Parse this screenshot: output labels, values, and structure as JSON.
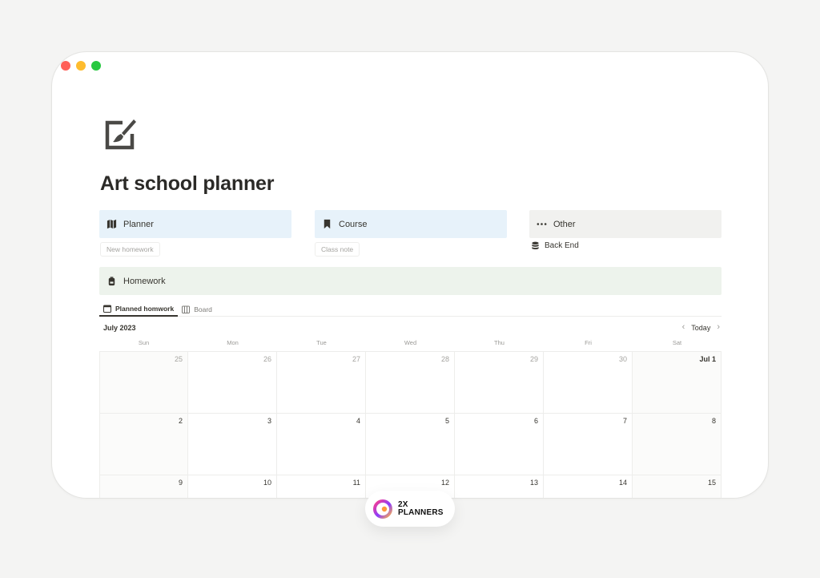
{
  "window": {
    "traffic_lights": {
      "close": "#ff5f57",
      "minimize": "#febc2e",
      "zoom": "#28c840"
    }
  },
  "page": {
    "icon": "edit-brush-icon",
    "title": "Art school planner"
  },
  "callouts": {
    "planner": {
      "icon": "map-icon",
      "label": "Planner",
      "color": "#e7f2fa"
    },
    "course": {
      "icon": "bookmark-icon",
      "label": "Course",
      "color": "#e7f2fa"
    },
    "other": {
      "icon": "more-horizontal-icon",
      "label": "Other",
      "color": "#f1f1ef"
    },
    "homework": {
      "icon": "backpack-icon",
      "label": "Homework",
      "color": "#edf3ec"
    }
  },
  "buttons": {
    "new_homework": "New homework",
    "class_note": "Class note"
  },
  "links": {
    "back_end": {
      "icon": "database-icon",
      "label": "Back End"
    }
  },
  "views": {
    "tabs": [
      {
        "icon": "calendar-icon",
        "label": "Planned homwork",
        "active": true
      },
      {
        "icon": "board-icon",
        "label": "Board",
        "active": false
      }
    ]
  },
  "calendar": {
    "month": "July 2023",
    "today_label": "Today",
    "prev_icon": "chevron-left-icon",
    "next_icon": "chevron-right-icon",
    "weekdays": [
      "Sun",
      "Mon",
      "Tue",
      "Wed",
      "Thu",
      "Fri",
      "Sat"
    ],
    "days": [
      "25",
      "26",
      "27",
      "28",
      "29",
      "30",
      "Jul 1",
      "2",
      "3",
      "4",
      "5",
      "6",
      "7",
      "8",
      "9",
      "10",
      "11",
      "12",
      "13",
      "14",
      "15"
    ]
  },
  "brand": {
    "logo_icon": "2x-planners-logo-icon",
    "line1": "2X",
    "line2": "PLANNERS"
  }
}
